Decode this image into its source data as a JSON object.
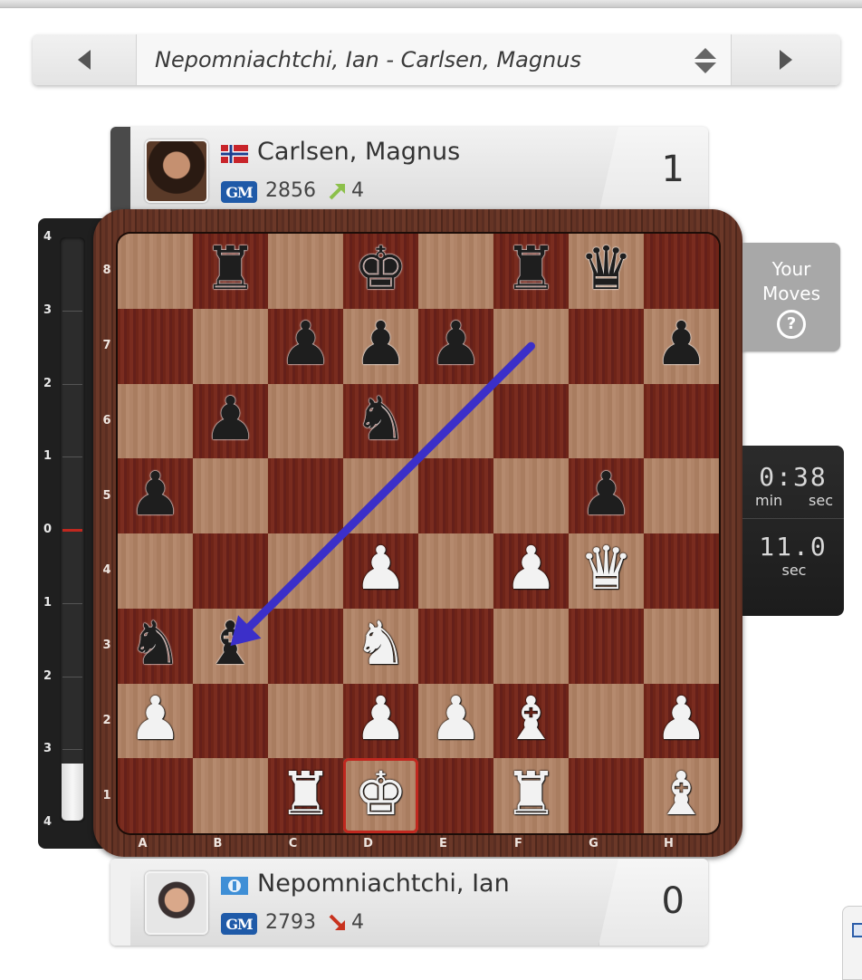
{
  "selector": {
    "title": "Nepomniachtchi, Ian - Carlsen, Magnus",
    "prev_icon": "triangle-left-icon",
    "next_icon": "triangle-right-icon",
    "dropdown_icon": "up-down-arrows-icon"
  },
  "players": {
    "top": {
      "name": "Carlsen, Magnus",
      "flag": "norway-flag",
      "title": "GM",
      "rating": "2856",
      "trend_direction": "up",
      "trend_value": "4",
      "score": "1"
    },
    "bottom": {
      "name": "Nepomniachtchi, Ian",
      "flag": "fide-flag",
      "title": "GM",
      "rating": "2793",
      "trend_direction": "down",
      "trend_value": "4",
      "score": "0"
    }
  },
  "eval_bar": {
    "ticks": [
      "4",
      "3",
      "2",
      "1",
      "0",
      "1",
      "2",
      "3",
      "4"
    ],
    "value": -3.2,
    "range": [
      -4,
      4
    ],
    "zero_color": "#c0281f"
  },
  "board": {
    "ranks": [
      "8",
      "7",
      "6",
      "5",
      "4",
      "3",
      "2",
      "1"
    ],
    "files": [
      "A",
      "B",
      "C",
      "D",
      "E",
      "F",
      "G",
      "H"
    ],
    "pieces": [
      {
        "square": "b8",
        "piece": "rook",
        "color": "b"
      },
      {
        "square": "d8",
        "piece": "king",
        "color": "b"
      },
      {
        "square": "f8",
        "piece": "rook",
        "color": "b"
      },
      {
        "square": "g8",
        "piece": "queen",
        "color": "b"
      },
      {
        "square": "c7",
        "piece": "pawn",
        "color": "b"
      },
      {
        "square": "d7",
        "piece": "pawn",
        "color": "b"
      },
      {
        "square": "e7",
        "piece": "pawn",
        "color": "b"
      },
      {
        "square": "h7",
        "piece": "pawn",
        "color": "b"
      },
      {
        "square": "b6",
        "piece": "pawn",
        "color": "b"
      },
      {
        "square": "d6",
        "piece": "knight",
        "color": "b"
      },
      {
        "square": "a5",
        "piece": "pawn",
        "color": "b"
      },
      {
        "square": "g5",
        "piece": "pawn",
        "color": "b"
      },
      {
        "square": "d4",
        "piece": "pawn",
        "color": "w"
      },
      {
        "square": "f4",
        "piece": "pawn",
        "color": "w"
      },
      {
        "square": "g4",
        "piece": "queen",
        "color": "w"
      },
      {
        "square": "a3",
        "piece": "knight",
        "color": "b"
      },
      {
        "square": "b3",
        "piece": "bishop",
        "color": "b"
      },
      {
        "square": "d3",
        "piece": "knight",
        "color": "w"
      },
      {
        "square": "a2",
        "piece": "pawn",
        "color": "w"
      },
      {
        "square": "d2",
        "piece": "pawn",
        "color": "w"
      },
      {
        "square": "e2",
        "piece": "pawn",
        "color": "w"
      },
      {
        "square": "f2",
        "piece": "bishop",
        "color": "w"
      },
      {
        "square": "h2",
        "piece": "pawn",
        "color": "w"
      },
      {
        "square": "c1",
        "piece": "rook",
        "color": "w"
      },
      {
        "square": "d1",
        "piece": "king",
        "color": "w"
      },
      {
        "square": "f1",
        "piece": "rook",
        "color": "w"
      },
      {
        "square": "h1",
        "piece": "bishop",
        "color": "w"
      }
    ],
    "check_square": "d1",
    "check_color": "#c0281f",
    "arrow": {
      "from": "f7",
      "to": "b3",
      "color": "#3b2fc9"
    }
  },
  "your_moves": {
    "line1": "Your",
    "line2": "Moves",
    "help_icon": "?"
  },
  "clock": {
    "main": "0:38",
    "main_unit_left": "min",
    "main_unit_right": "sec",
    "increment": "11.0",
    "increment_unit": "sec"
  }
}
